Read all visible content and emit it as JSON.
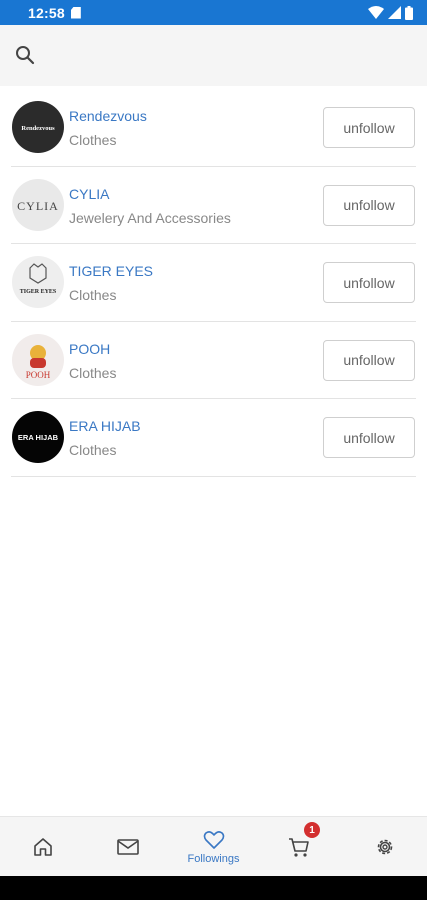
{
  "status_bar": {
    "time": "12:58"
  },
  "followings": [
    {
      "name": "Rendezvous",
      "category": "Clothes",
      "logo_text": "Rendezvous",
      "button": "unfollow"
    },
    {
      "name": "CYLIA",
      "category": "Jewelery And Accessories",
      "logo_text": "CYLIA",
      "button": "unfollow"
    },
    {
      "name": "TIGER EYES",
      "category": "Clothes",
      "logo_text": "TIGER EYES",
      "button": "unfollow"
    },
    {
      "name": "POOH",
      "category": "Clothes",
      "logo_text": "POOH",
      "button": "unfollow"
    },
    {
      "name": "ERA HIJAB",
      "category": "Clothes",
      "logo_text": "ERA HIJAB",
      "button": "unfollow"
    }
  ],
  "bottom_nav": {
    "items": [
      {
        "icon": "home-icon"
      },
      {
        "icon": "mail-icon"
      },
      {
        "icon": "heart-icon",
        "label": "Followings",
        "active": true
      },
      {
        "icon": "cart-icon",
        "badge": "1"
      },
      {
        "icon": "gear-icon"
      }
    ]
  },
  "colors": {
    "accent": "#3a78c4",
    "status_bar": "#1976d2",
    "badge": "#d32f2f"
  }
}
